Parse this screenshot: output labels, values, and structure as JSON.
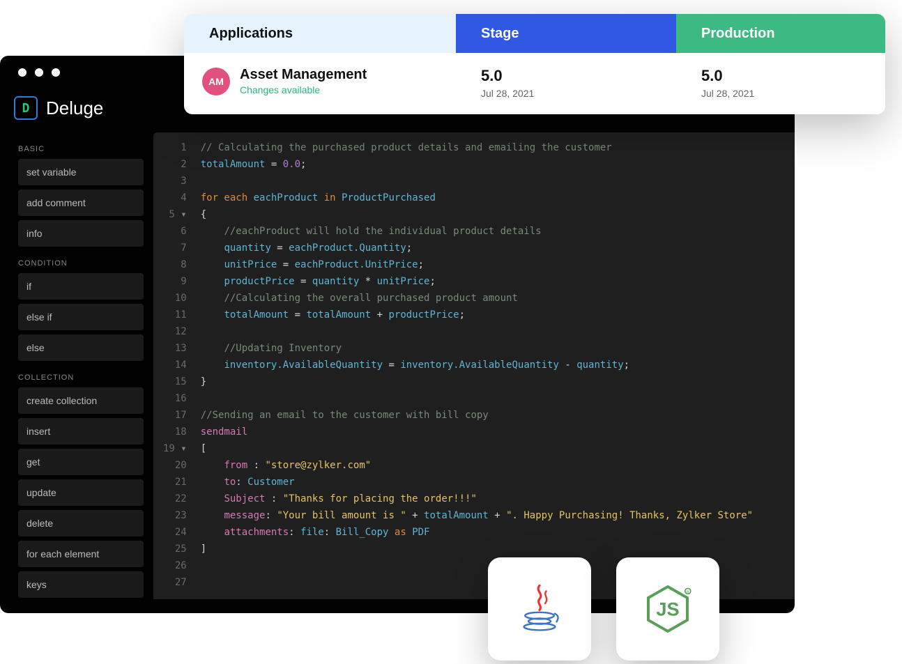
{
  "brand": {
    "name": "Deluge",
    "icon_letter": "D"
  },
  "top": {
    "headers": {
      "applications": "Applications",
      "stage": "Stage",
      "production": "Production"
    },
    "app": {
      "badge": "AM",
      "name": "Asset Management",
      "status": "Changes available"
    },
    "stage": {
      "version": "5.0",
      "date": "Jul 28, 2021"
    },
    "production": {
      "version": "5.0",
      "date": "Jul 28, 2021"
    }
  },
  "sidebar": {
    "sections": [
      {
        "title": "BASIC",
        "items": [
          "set variable",
          "add comment",
          "info"
        ]
      },
      {
        "title": "CONDITION",
        "items": [
          "if",
          "else if",
          "else"
        ]
      },
      {
        "title": "COLLECTION",
        "items": [
          "create collection",
          "insert",
          "get",
          "update",
          "delete",
          "for each element",
          "keys"
        ]
      }
    ]
  },
  "code": {
    "lines": [
      {
        "n": 1,
        "tokens": [
          [
            "comment",
            "// Calculating the purchased product details and emailing the customer"
          ]
        ]
      },
      {
        "n": 2,
        "tokens": [
          [
            "ident",
            "totalAmount"
          ],
          [
            "punc",
            " = "
          ],
          [
            "number",
            "0.0"
          ],
          [
            "punc",
            ";"
          ]
        ]
      },
      {
        "n": 3,
        "tokens": []
      },
      {
        "n": 4,
        "tokens": [
          [
            "keyword",
            "for each"
          ],
          [
            "punc",
            " "
          ],
          [
            "ident",
            "eachProduct"
          ],
          [
            "punc",
            " "
          ],
          [
            "keyword",
            "in"
          ],
          [
            "punc",
            " "
          ],
          [
            "ident",
            "ProductPurchased"
          ]
        ]
      },
      {
        "n": 5,
        "fold": true,
        "tokens": [
          [
            "punc",
            "{"
          ]
        ]
      },
      {
        "n": 6,
        "indent": 1,
        "tokens": [
          [
            "comment",
            "//eachProduct will hold the individual product details"
          ]
        ]
      },
      {
        "n": 7,
        "indent": 1,
        "tokens": [
          [
            "ident",
            "quantity"
          ],
          [
            "punc",
            " = "
          ],
          [
            "ident",
            "eachProduct.Quantity"
          ],
          [
            "punc",
            ";"
          ]
        ]
      },
      {
        "n": 8,
        "indent": 1,
        "tokens": [
          [
            "ident",
            "unitPrice"
          ],
          [
            "punc",
            " = "
          ],
          [
            "ident",
            "eachProduct.UnitPrice"
          ],
          [
            "punc",
            ";"
          ]
        ]
      },
      {
        "n": 9,
        "indent": 1,
        "tokens": [
          [
            "ident",
            "productPrice"
          ],
          [
            "punc",
            " = "
          ],
          [
            "ident",
            "quantity"
          ],
          [
            "punc",
            " * "
          ],
          [
            "ident",
            "unitPrice"
          ],
          [
            "punc",
            ";"
          ]
        ]
      },
      {
        "n": 10,
        "indent": 1,
        "tokens": [
          [
            "comment",
            "//Calculating the overall purchased product amount"
          ]
        ]
      },
      {
        "n": 11,
        "indent": 1,
        "tokens": [
          [
            "ident",
            "totalAmount"
          ],
          [
            "punc",
            " = "
          ],
          [
            "ident",
            "totalAmount"
          ],
          [
            "punc",
            " + "
          ],
          [
            "ident",
            "productPrice"
          ],
          [
            "punc",
            ";"
          ]
        ]
      },
      {
        "n": 12,
        "tokens": []
      },
      {
        "n": 13,
        "indent": 1,
        "tokens": [
          [
            "comment",
            "//Updating Inventory"
          ]
        ]
      },
      {
        "n": 14,
        "indent": 1,
        "tokens": [
          [
            "ident",
            "inventory.AvailableQuantity"
          ],
          [
            "punc",
            " = "
          ],
          [
            "ident",
            "inventory.AvailableQuantity"
          ],
          [
            "punc",
            " - "
          ],
          [
            "ident",
            "quantity"
          ],
          [
            "punc",
            ";"
          ]
        ]
      },
      {
        "n": 15,
        "tokens": [
          [
            "punc",
            "}"
          ]
        ]
      },
      {
        "n": 16,
        "tokens": []
      },
      {
        "n": 17,
        "tokens": [
          [
            "comment",
            "//Sending an email to the customer with bill copy"
          ]
        ]
      },
      {
        "n": 18,
        "tokens": [
          [
            "call",
            "sendmail"
          ]
        ]
      },
      {
        "n": 19,
        "fold": true,
        "tokens": [
          [
            "punc",
            "["
          ]
        ]
      },
      {
        "n": 20,
        "indent": 1,
        "tokens": [
          [
            "call",
            "from"
          ],
          [
            "punc",
            " : "
          ],
          [
            "string",
            "\"store@zylker.com\""
          ]
        ]
      },
      {
        "n": 21,
        "indent": 1,
        "tokens": [
          [
            "call",
            "to"
          ],
          [
            "punc",
            ": "
          ],
          [
            "ident",
            "Customer"
          ]
        ]
      },
      {
        "n": 22,
        "indent": 1,
        "tokens": [
          [
            "call",
            "Subject"
          ],
          [
            "punc",
            " : "
          ],
          [
            "string",
            "\"Thanks for placing the order!!!\""
          ]
        ]
      },
      {
        "n": 23,
        "indent": 1,
        "tokens": [
          [
            "call",
            "message"
          ],
          [
            "punc",
            ": "
          ],
          [
            "string",
            "\"Your bill amount is \""
          ],
          [
            "punc",
            " + "
          ],
          [
            "ident",
            "totalAmount"
          ],
          [
            "punc",
            " + "
          ],
          [
            "string",
            "\". Happy Purchasing! Thanks, Zylker Store\""
          ]
        ]
      },
      {
        "n": 24,
        "indent": 1,
        "tokens": [
          [
            "call",
            "attachments"
          ],
          [
            "punc",
            ": "
          ],
          [
            "ident",
            "file"
          ],
          [
            "punc",
            ": "
          ],
          [
            "ident",
            "Bill_Copy"
          ],
          [
            "punc",
            " "
          ],
          [
            "keyword",
            "as"
          ],
          [
            "punc",
            " "
          ],
          [
            "ident",
            "PDF"
          ]
        ]
      },
      {
        "n": 25,
        "tokens": [
          [
            "punc",
            "]"
          ]
        ]
      },
      {
        "n": 26,
        "tokens": []
      },
      {
        "n": 27,
        "tokens": []
      }
    ]
  },
  "tech": {
    "java": "Java",
    "node": "Node.js"
  }
}
